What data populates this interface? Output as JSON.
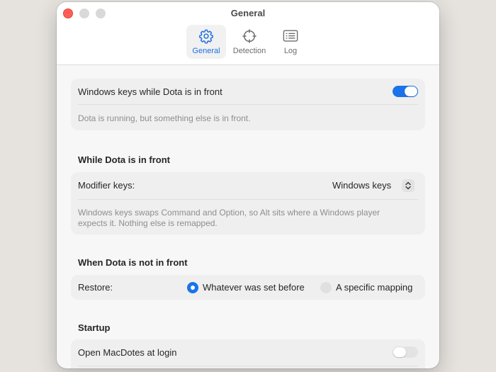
{
  "window": {
    "title": "General",
    "tabs": [
      {
        "label": "General",
        "icon": "gear-icon",
        "active": true
      },
      {
        "label": "Detection",
        "icon": "crosshair-icon",
        "active": false
      },
      {
        "label": "Log",
        "icon": "list-icon",
        "active": false
      }
    ]
  },
  "main": {
    "windows_keys_toggle": {
      "label": "Windows keys while Dota is in front",
      "enabled": true,
      "status": "Dota is running, but something else is in front."
    },
    "front_section": {
      "heading": "While Dota is in front",
      "modifier_label": "Modifier keys:",
      "modifier_value": "Windows keys",
      "description_line1": "Windows keys swaps Command and Option, so Alt sits where a Windows player",
      "description_line2": "expects it. Nothing else is remapped."
    },
    "not_front_section": {
      "heading": "When Dota is not in front",
      "restore_label": "Restore:",
      "options": [
        {
          "label": "Whatever was set before",
          "selected": true
        },
        {
          "label": "A specific mapping",
          "selected": false
        }
      ]
    },
    "startup_section": {
      "heading": "Startup",
      "login_label": "Open MacDotes at login",
      "enabled": false
    }
  },
  "colors": {
    "accent": "#1a73e8",
    "close": "#ff5f57"
  }
}
